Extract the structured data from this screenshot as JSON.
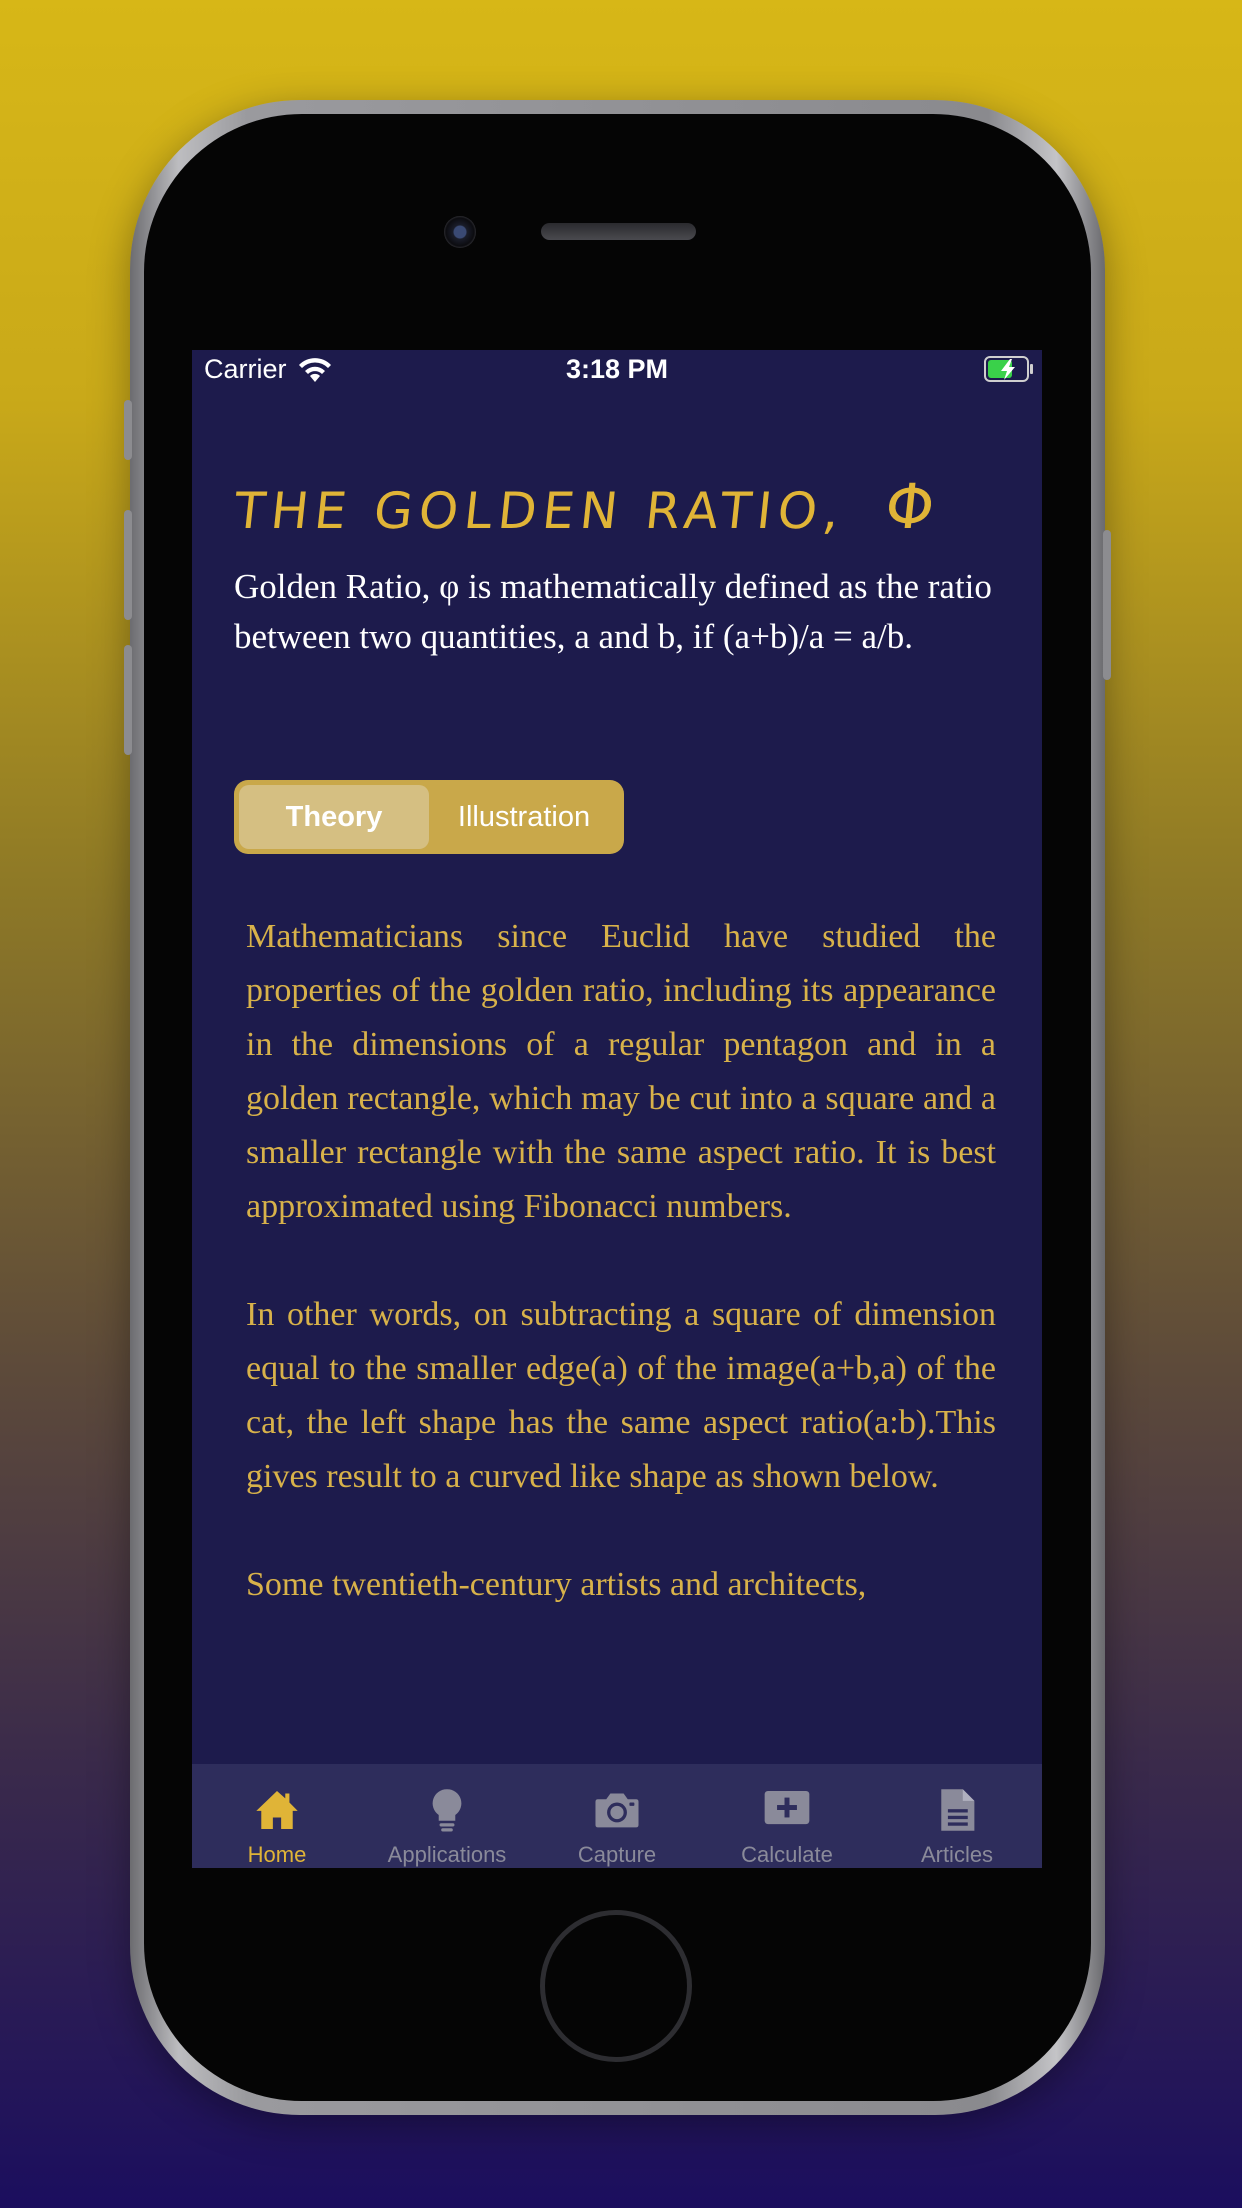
{
  "status_bar": {
    "carrier": "Carrier",
    "time": "3:18 PM"
  },
  "header": {
    "title": "THE GOLDEN RATIO,",
    "symbol": "Φ"
  },
  "intro": "Golden Ratio,  φ is mathematically defined as the ratio between two quantities, a and b, if (a+b)/a = a/b.",
  "segments": {
    "items": [
      "Theory",
      "Illustration"
    ],
    "selected": "Theory"
  },
  "article": {
    "paragraphs": [
      "Mathematicians since Euclid have studied the properties of the golden ratio, including its appearance in the dimensions of a regular pentagon and in a golden rectangle, which may be cut into a square and a smaller rectangle with the same aspect ratio. It is best approximated using Fibonacci numbers.",
      "In other words, on subtracting a square of dimension equal to the smaller edge(a) of the image(a+b,a) of the cat, the left shape has the same aspect ratio(a:b).This gives result to a curved like shape as shown below.",
      "Some twentieth-century artists and architects,"
    ]
  },
  "tab_bar": {
    "items": [
      {
        "label": "Home",
        "icon": "home-icon",
        "active": true
      },
      {
        "label": "Applications",
        "icon": "lightbulb-icon",
        "active": false
      },
      {
        "label": "Capture",
        "icon": "camera-icon",
        "active": false
      },
      {
        "label": "Calculate",
        "icon": "plus-square-icon",
        "active": false
      },
      {
        "label": "Articles",
        "icon": "document-icon",
        "active": false
      }
    ]
  },
  "colors": {
    "background_top": "#d7b717",
    "background_bottom": "#1b0e5e",
    "screen": "#1d1b4c",
    "accent_gold": "#e0b437",
    "segment_bg": "#c9a84a",
    "segment_active": "#d5bf82",
    "tab_bar": "#2e2d5c",
    "tab_inactive": "#8a8a9a"
  }
}
